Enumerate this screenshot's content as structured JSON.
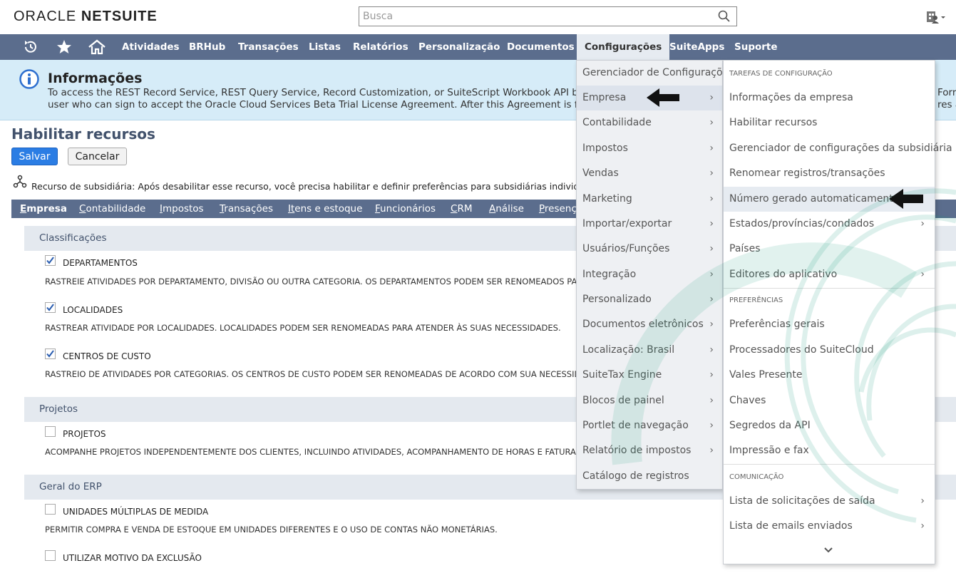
{
  "header": {
    "logo_text_a": "ORACLE",
    "logo_text_b": "NETSUITE",
    "search_placeholder": "Busca"
  },
  "nav": {
    "items": [
      "Atividades",
      "BRHub",
      "Transações",
      "Listas",
      "Relatórios",
      "Personalização",
      "Documentos",
      "Configurações",
      "SuiteApps",
      "Suporte"
    ]
  },
  "info": {
    "title": "Informações",
    "line1": "To access the REST Record Service, REST Query Service, Record Customization, or SuiteScript Workbook API beta featu",
    "line2": "user who can sign to accept the Oracle Cloud Services Beta Trial License Agreement. After this Agreement is fully exec",
    "line1_right": "Forr",
    "line2_right": "res a"
  },
  "page": {
    "title": "Habilitar recursos",
    "save_label": "Salvar",
    "cancel_label": "Cancelar",
    "subsidiary_note": "Recurso de subsidiária: Após desabilitar esse recurso, você precisa habilitar e definir preferências para subsidiárias individuais usar"
  },
  "tabs": [
    {
      "label": "Empresa",
      "underline": "E",
      "rest": "mpresa"
    },
    {
      "label": "Contabilidade",
      "underline": "C",
      "rest": "ontabilidade"
    },
    {
      "label": "Impostos",
      "underline": "I",
      "rest": "mpostos"
    },
    {
      "label": "Transações",
      "underline": "T",
      "rest": "ransações"
    },
    {
      "label": "Itens e estoque",
      "underline": "It",
      "rest": "ens e estoque"
    },
    {
      "label": "Funcionários",
      "underline": "F",
      "rest": "uncionários"
    },
    {
      "label": "CRM",
      "underline": "C",
      "rest": "RM"
    },
    {
      "label": "Análise",
      "underline": "A",
      "rest": "nálise"
    },
    {
      "label": "Presenç",
      "underline": "P",
      "rest": "resenç"
    }
  ],
  "sections": {
    "classificacoes": "Classificações",
    "projetos": "Projetos",
    "geral_erp": "Geral do ERP"
  },
  "features": {
    "departamentos": {
      "label": "DEPARTAMENTOS",
      "checked": true,
      "desc": "RASTREIE ATIVIDADES POR DEPARTAMENTO, DIVISÃO OU OUTRA CATEGORIA. OS DEPARTAMENTOS PODEM SER RENOMEADOS PARA ATEN"
    },
    "localidades": {
      "label": "LOCALIDADES",
      "checked": true,
      "desc": "RASTREAR ATIVIDADE POR LOCALIDADES. LOCALIDADES PODEM SER RENOMEADAS PARA ATENDER ÀS SUAS NECESSIDADES."
    },
    "centros_custo": {
      "label": "CENTROS DE CUSTO",
      "checked": true,
      "desc": "RASTREIO DE ATIVIDADES POR CATEGORIAS. OS CENTROS DE CUSTO PODEM SER RENOMEADAS DE ACORDO COM SUA NECESSIDADE."
    },
    "projetos": {
      "label": "PROJETOS",
      "checked": false,
      "desc": "ACOMPANHE PROJETOS INDEPENDENTEMENTE DOS CLIENTES, INCLUINDO ATIVIDADES, ACOMPANHAMENTO DE HORAS E FATURAMENTO"
    },
    "unidades": {
      "label": "UNIDADES MÚLTIPLAS DE MEDIDA",
      "checked": false,
      "desc": "PERMITIR COMPRA E VENDA DE ESTOQUE EM UNIDADES DIFERENTES E O USO DE CONTAS NÃO MONETÁRIAS."
    },
    "motivo": {
      "label": "UTILIZAR MOTIVO DA EXCLUSÃO",
      "checked": false
    }
  },
  "menu_config": {
    "items": [
      "Gerenciador de Configurações",
      "Empresa",
      "Contabilidade",
      "Impostos",
      "Vendas",
      "Marketing",
      "Importar/exportar",
      "Usuários/Funções",
      "Integração",
      "Personalizado",
      "Documentos eletrônicos",
      "Localização: Brasil",
      "SuiteTax Engine",
      "Blocos de painel",
      "Portlet de navegação",
      "Relatório de impostos",
      "Catálogo de registros"
    ]
  },
  "menu_empresa": {
    "header_tarefas": "TAREFAS DE CONFIGURAÇÃO",
    "tarefas": [
      "Informações da empresa",
      "Habilitar recursos",
      "Gerenciador de configurações da subsidiária",
      "Renomear registros/transações",
      "Número gerado automaticamente",
      "Estados/províncias/condados",
      "Países",
      "Editores do aplicativo"
    ],
    "header_pref": "PREFERÊNCIAS",
    "preferencias": [
      "Preferências gerais",
      "Processadores do SuiteCloud",
      "Vales Presente",
      "Chaves",
      "Segredos da API",
      "Impressão e fax"
    ],
    "header_com": "COMUNICAÇÃO",
    "comunicacao": [
      "Lista de solicitações de saída",
      "Lista de emails enviados"
    ]
  }
}
